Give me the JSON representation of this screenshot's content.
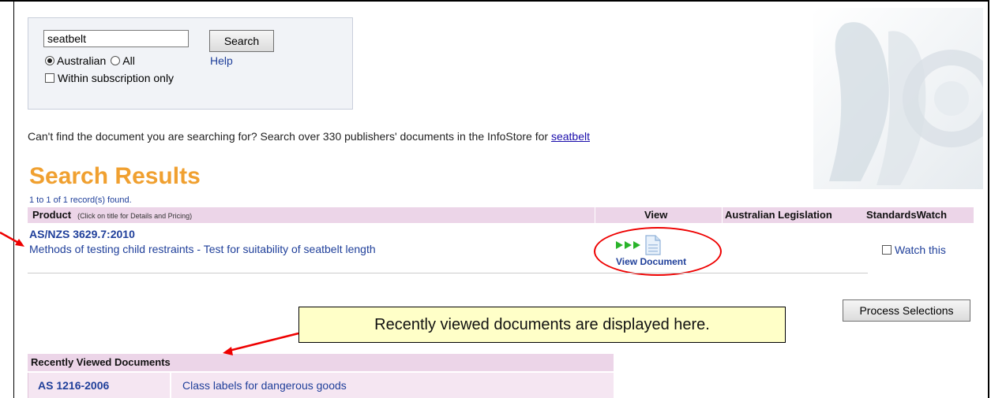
{
  "search": {
    "value": "seatbelt",
    "button_label": "Search",
    "help_label": "Help",
    "scope_options": [
      "Australian",
      "All"
    ],
    "scope_selected": "Australian",
    "subscription_label": "Within subscription only"
  },
  "notice": {
    "text": "Can't find the document you are searching for? Search over 330 publishers' documents in the InfoStore for ",
    "link_label": "seatbelt"
  },
  "results": {
    "title": "Search Results",
    "count_text": "1 to 1 of 1 record(s) found.",
    "columns": {
      "product": "Product",
      "product_note": "(Click on title for Details and Pricing)",
      "view": "View",
      "legislation": "Australian Legislation",
      "watch": "StandardsWatch"
    },
    "rows": [
      {
        "code": "AS/NZS 3629.7:2010",
        "title": "Methods of testing child restraints - Test for suitability of seatbelt length",
        "view_label": "View Document",
        "watch_label": "Watch this"
      }
    ],
    "process_label": "Process Selections"
  },
  "callout": {
    "text": "Recently viewed documents are displayed here."
  },
  "recent": {
    "header": "Recently Viewed Documents",
    "rows": [
      {
        "code": "AS 1216-2006",
        "title": "Class labels for dangerous goods"
      }
    ]
  },
  "colors": {
    "accent_orange": "#f0a030",
    "link_blue": "#1f3f9a",
    "header_pink": "#ecd5e8",
    "annotation_red": "#e00000",
    "callout_yellow": "#ffffc8"
  }
}
